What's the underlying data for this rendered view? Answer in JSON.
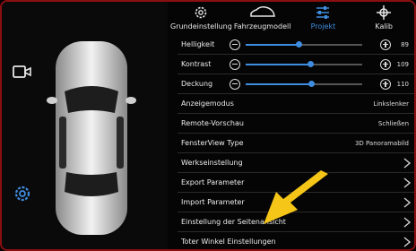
{
  "tabs": [
    {
      "label": "Grundeinstellung",
      "icon": "gear-icon",
      "active": false
    },
    {
      "label": "Fahrzeugmodell",
      "icon": "car-icon",
      "active": false
    },
    {
      "label": "Projekt",
      "icon": "sliders-icon",
      "active": true
    },
    {
      "label": "Kalib",
      "icon": "crosshair-icon",
      "active": false
    }
  ],
  "sliders": [
    {
      "label": "Helligkeit",
      "value": "89",
      "level": 0.45
    },
    {
      "label": "Kontrast",
      "value": "109",
      "level": 0.55
    },
    {
      "label": "Deckung",
      "value": "110",
      "level": 0.56
    }
  ],
  "rows": [
    {
      "label": "Anzeigemodus",
      "value": "Linkslenker"
    },
    {
      "label": "Remote-Vorschau",
      "value": "Schließen"
    },
    {
      "label": "FensterView Type",
      "value": "3D Panoramabild"
    }
  ],
  "nav_rows": [
    {
      "label": "Werkseinstellung"
    },
    {
      "label": "Export Parameter"
    },
    {
      "label": "Import Parameter"
    },
    {
      "label": "Einstellung der Seitenansicht"
    },
    {
      "label": "Toter Winkel Einstellungen"
    }
  ],
  "colors": {
    "accent": "#3f8de0",
    "arrow": "#f5c518",
    "border": "#8b0f10"
  }
}
